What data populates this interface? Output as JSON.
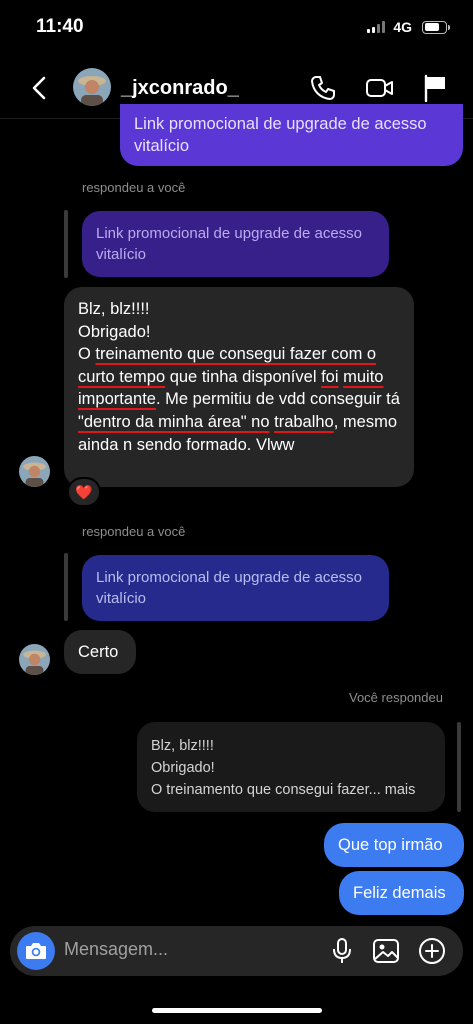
{
  "status_bar": {
    "time": "11:40",
    "network": "4G",
    "battery_level": 0.7
  },
  "header": {
    "username": "_jxconrado_"
  },
  "messages": {
    "top_partial": "Link promocional de upgrade de acesso vitalício",
    "reply_label_1": "respondeu a você",
    "quoted_1": "Link promocional de upgrade de acesso vitalício",
    "long_msg": {
      "line1": "Blz, blz!!!!",
      "line2": "Obrigado!",
      "seg_o": "O ",
      "seg_hl1": "treinamento que consegui fazer com o",
      "seg_hl2": "curto tempo",
      "seg_que_tinha": " que tinha disponível ",
      "seg_hl3": "foi",
      "seg_hl4": "muito importante",
      "seg_me_permitiu": ". Me permitiu de vdd conseguir tá ",
      "seg_hl5": "\"dentro da minha área\" no",
      "seg_hl6": "trabalho",
      "seg_end": ", mesmo ainda n sendo formado. Vlww"
    },
    "reaction": "❤️",
    "reply_label_2": "respondeu a você",
    "quoted_2": "Link promocional de upgrade de acesso vitalício",
    "certo": "Certo",
    "you_replied_label": "Você respondeu",
    "own_quote": {
      "line1": "Blz, blz!!!!",
      "line2": "Obrigado!",
      "line3": "O treinamento que consegui fazer... mais"
    },
    "sent_1": "Que top irmão",
    "sent_2": "Feliz demais"
  },
  "composer": {
    "placeholder": "Mensagem..."
  },
  "colors": {
    "accent_blue": "#3d7bf0",
    "purple": "#5b37d6",
    "highlight_red": "#e0161b"
  }
}
